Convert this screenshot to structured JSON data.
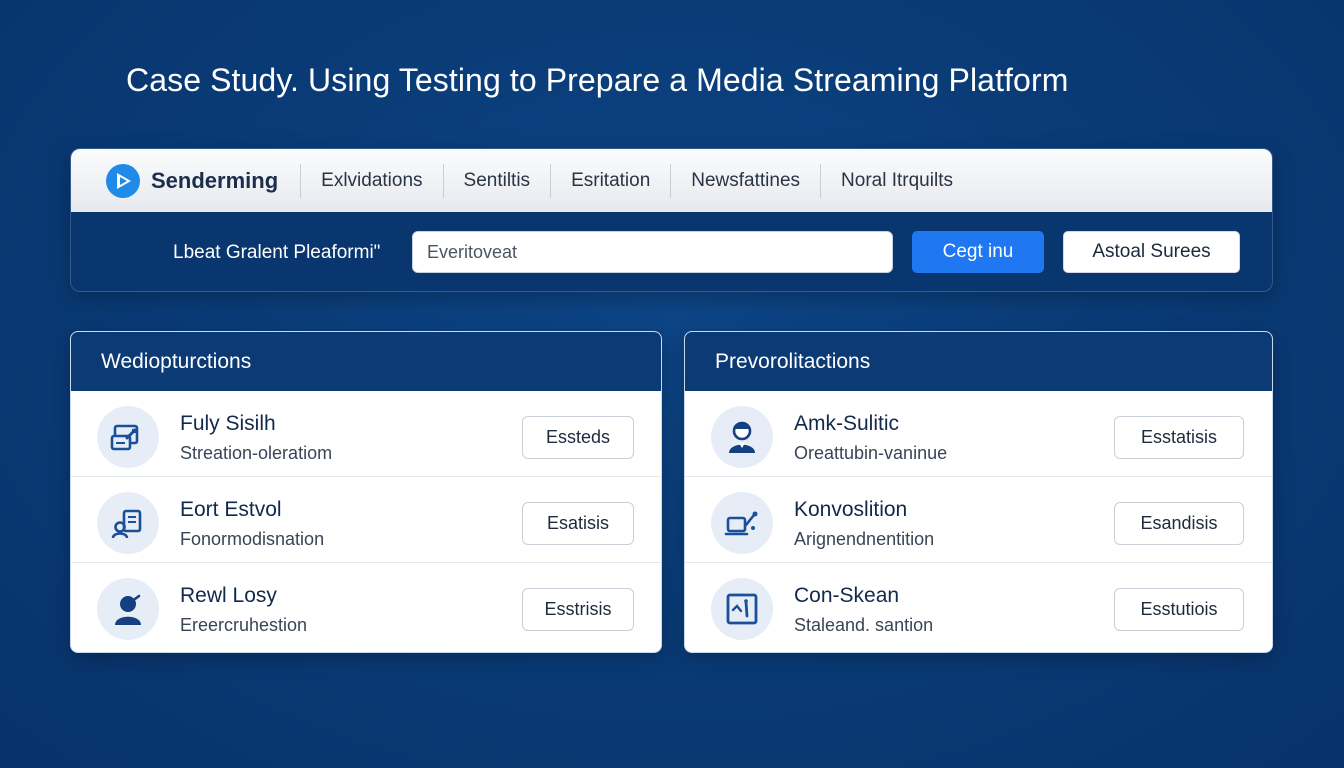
{
  "page": {
    "title": "Case Study. Using Testing to Prepare a Media Streaming Platform"
  },
  "app": {
    "brand_name": "Senderming",
    "brand_icon": "play-logo-icon",
    "nav_items": [
      {
        "label": "Exlvidations"
      },
      {
        "label": "Sentiltis"
      },
      {
        "label": "Esritation"
      },
      {
        "label": "Newsfattines"
      },
      {
        "label": "Noral Itrquilts"
      }
    ]
  },
  "toolbar": {
    "label": "Lbeat Gralent Pleaformi\"",
    "input_value": "Everitoveat",
    "primary_button": "Cegt inu",
    "secondary_button": "Astoal Surees"
  },
  "left_panel": {
    "header": "Wediopturctions",
    "items": [
      {
        "title": "Fuly Sisilh",
        "subtitle": "Streation-oleratiom",
        "button": "Essteds",
        "icon": "media-edit-icon"
      },
      {
        "title": "Eort Estvol",
        "subtitle": "Fonormodisnation",
        "button": "Esatisis",
        "icon": "user-document-icon"
      },
      {
        "title": "Rewl Losy",
        "subtitle": "Ereercruhestion",
        "button": "Esstrisis",
        "icon": "user-icon"
      }
    ]
  },
  "right_panel": {
    "header": "Prevorolitactions",
    "items": [
      {
        "title": "Amk-Sulitic",
        "subtitle": "Oreattubin-vaninue",
        "button": "Esstatisis",
        "icon": "person-avatar-icon"
      },
      {
        "title": "Konvoslition",
        "subtitle": "Arignendnentition",
        "button": "Esandisis",
        "icon": "device-link-icon"
      },
      {
        "title": "Con-Skean",
        "subtitle": "Staleand. santion",
        "button": "Esstutiois",
        "icon": "frame-chart-icon"
      }
    ]
  },
  "colors": {
    "background": "#0a3c78",
    "accent": "#1f77f2",
    "panel_header": "#0c3a75",
    "icon_blue": "#1a4f99"
  }
}
